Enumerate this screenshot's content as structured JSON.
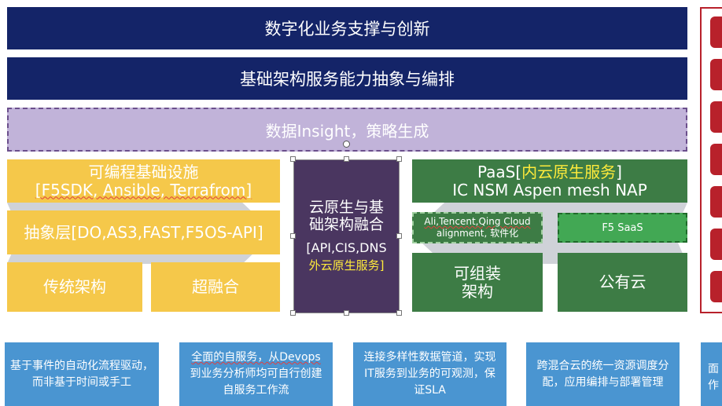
{
  "top_bar": {
    "title": "数字化业务支撑与创新"
  },
  "second_bar": {
    "title": "基础架构服务能力抽象与编排"
  },
  "insight_bar": {
    "title": "数据Insight，策略生成"
  },
  "left_block": {
    "programmable": {
      "line1": "可编程基础设施",
      "line2": "[F5SDK, Ansible, Terrafrom]"
    },
    "abstraction": {
      "label": "抽象层[DO,AS3,FAST,F5OS-API]"
    },
    "traditional": {
      "label": "传统架构"
    },
    "hyperconverged": {
      "label": "超融合"
    }
  },
  "center_block": {
    "line1": "云原生与基",
    "line2": "础架构融合",
    "line3": "[API,CIS,DNS",
    "line4": "外云原生服务]"
  },
  "right_block": {
    "paas": {
      "prefix": "PaaS[",
      "highlight": "内云原生服务",
      "suffix": "]",
      "line2": "IC NSM Aspen mesh NAP"
    },
    "cloud_alignment": {
      "line1": "Ali,Tencent,Qing Cloud",
      "line2": "alignment, 软件化"
    },
    "f5_saas": {
      "label": "F5 SaaS"
    },
    "composable": {
      "line1": "可组装",
      "line2": "架构"
    },
    "public_cloud": {
      "label": "公有云"
    }
  },
  "cards": [
    {
      "line1": "基于事件的自动化流程驱动，",
      "line2": "而非基于时间或手工"
    },
    {
      "line1": "全面的自服务，从Devops",
      "line2": "到业务分析师均可自行创建",
      "line3": "自服务工作流"
    },
    {
      "line1": "连接多样性数据管道，实现",
      "line2": "IT服务到业务的可观测，保",
      "line3": "证SLA"
    },
    {
      "line1": "跨混合云的统一资源调度分",
      "line2": "配，应用编排与部署管理"
    },
    {
      "line1": "面",
      "line2": "作"
    }
  ],
  "colors": {
    "navy": "#142468",
    "lavender": "#c1b3d9",
    "yellow": "#f5c84a",
    "dark_purple": "#4a3660",
    "green": "#3d7c45",
    "bright_green": "#42a854",
    "card_blue": "#4a95d1",
    "red": "#b8212b"
  }
}
